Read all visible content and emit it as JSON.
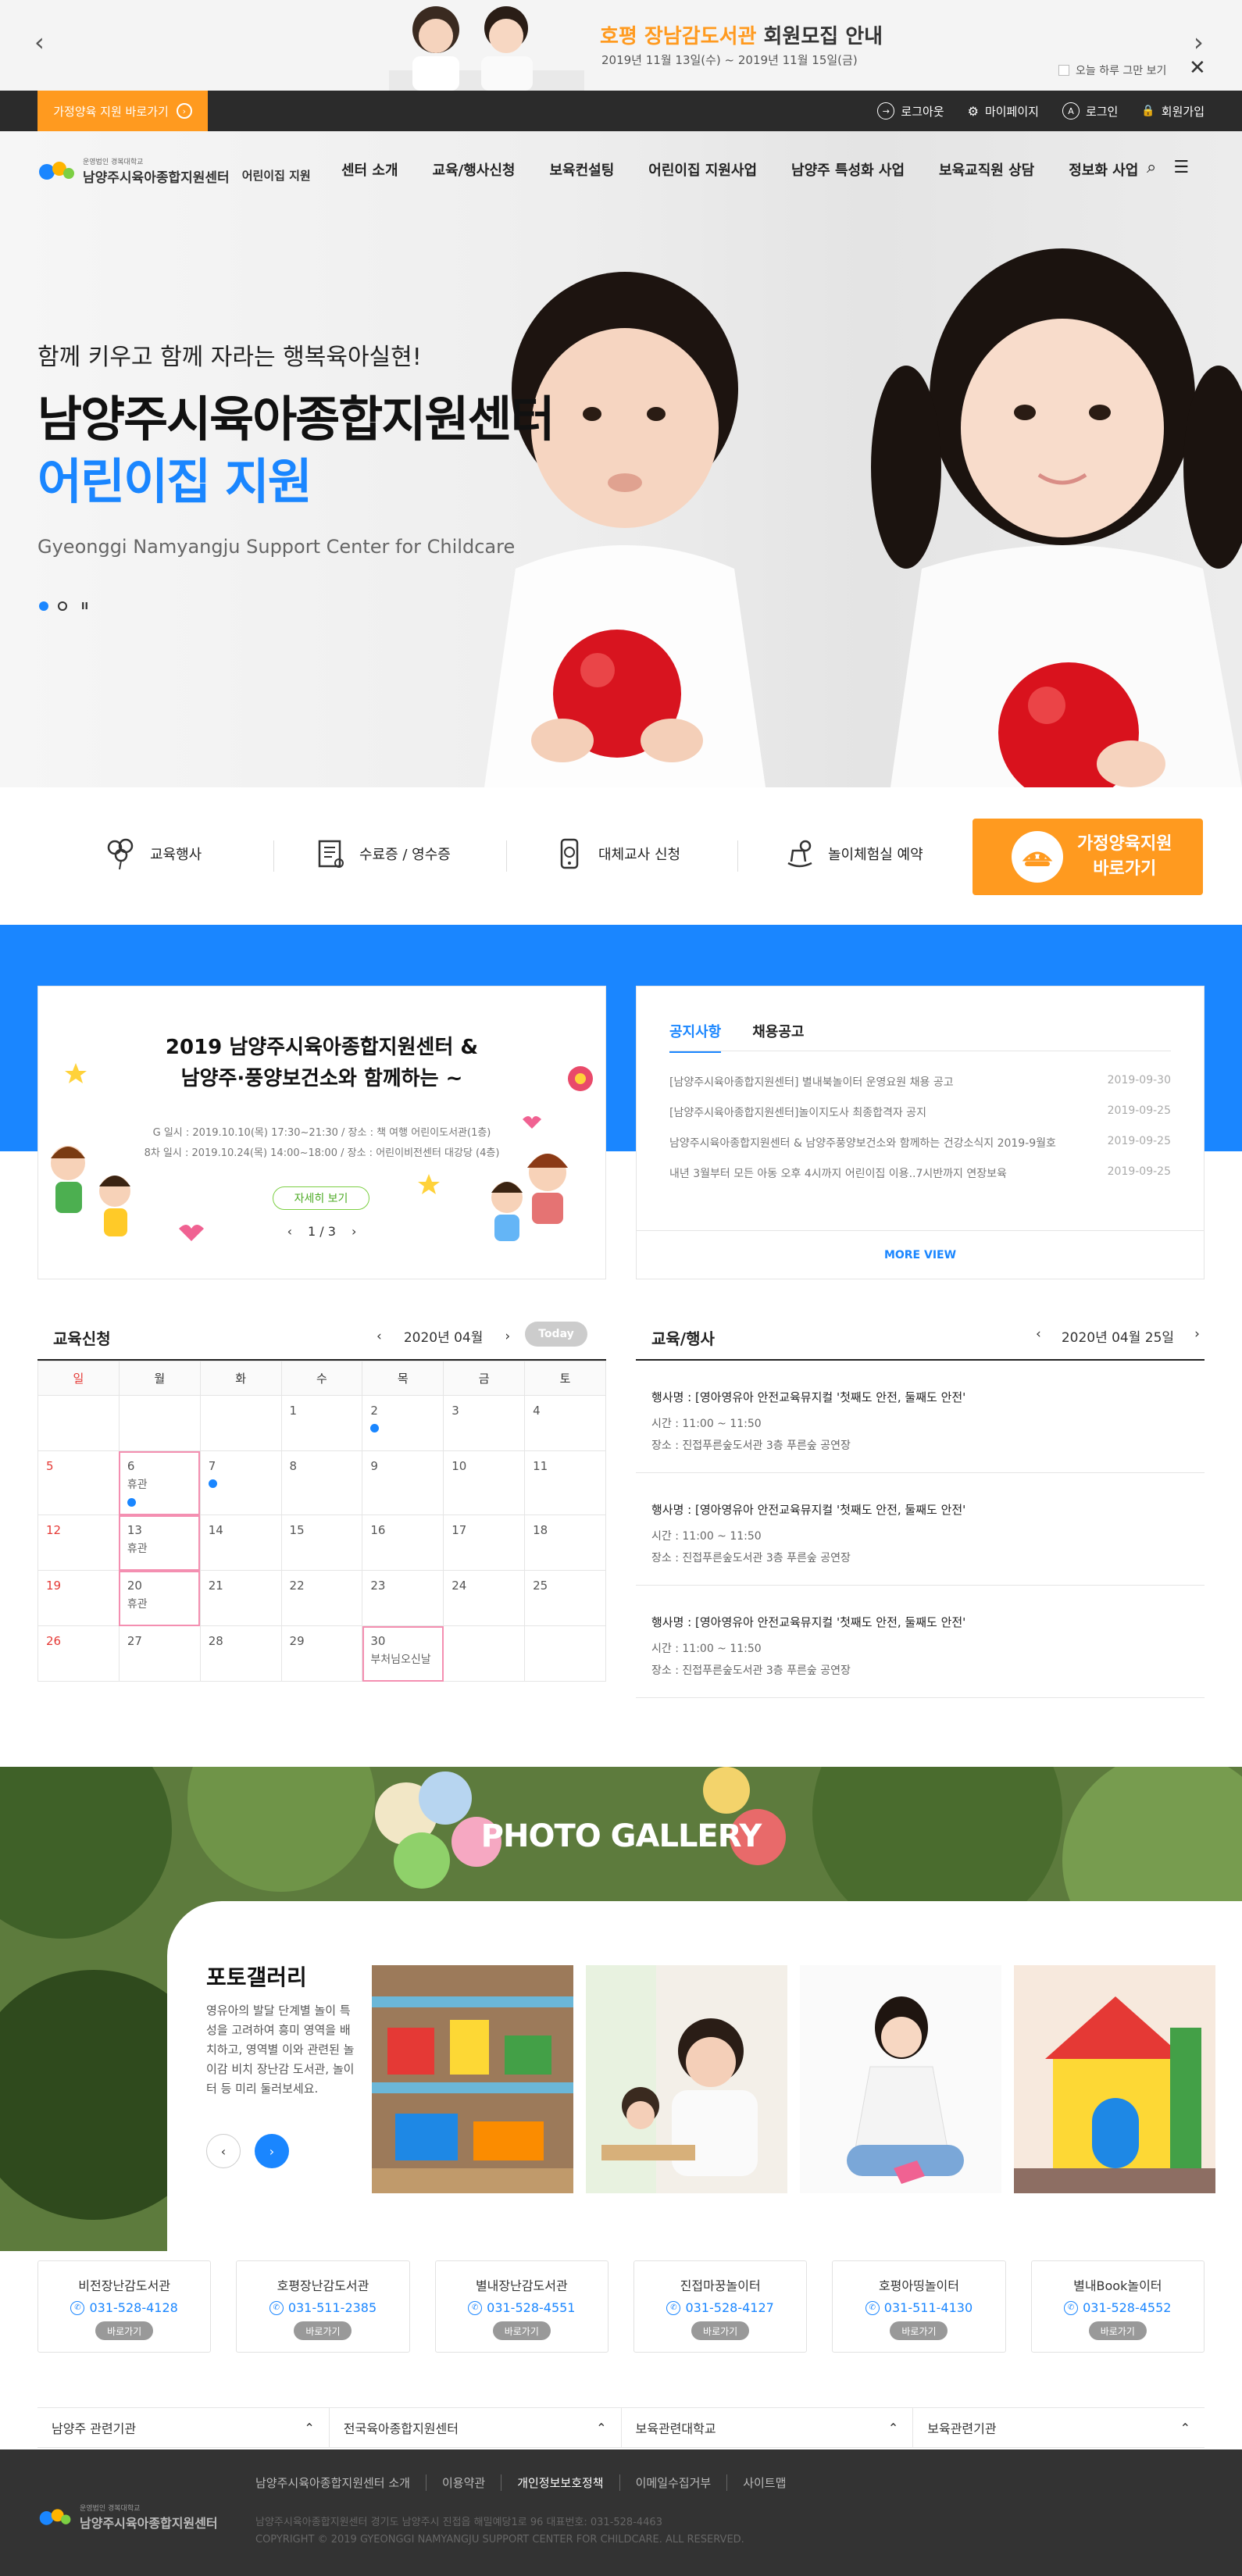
{
  "promo": {
    "title_highlight": "호평 장남감도서관",
    "title_rest": " 회원모집 안내",
    "date": "2019년 11월 13일(수) ~ 2019년 11월 15일(금)",
    "today_label": "오늘 하루 그만 보기",
    "close_icon": "close-icon",
    "prev_icon": "chevron-left-icon",
    "next_icon": "chevron-right-icon"
  },
  "util": {
    "home_btn": "가정양육 지원 바로가기",
    "links": [
      {
        "label": "로그아웃",
        "icon": "logout-icon",
        "glyph": "→"
      },
      {
        "label": "마이페이지",
        "icon": "gear-icon",
        "glyph": "⚙"
      },
      {
        "label": "로그인",
        "icon": "login-icon",
        "glyph": "A"
      },
      {
        "label": "회원가입",
        "icon": "lock-icon",
        "glyph": "🔒"
      }
    ]
  },
  "gnb": {
    "logo_small": "운영법인 경복대학교",
    "logo_name": "남양주시육아종합지원센터",
    "logo_sub": "어린이집 지원",
    "menu": [
      "센터 소개",
      "교육/행사신청",
      "보육컨설팅",
      "어린이집 지원사업",
      "남양주 특성화 사업",
      "보육교직원 상담",
      "정보화 사업"
    ]
  },
  "hero": {
    "slogan": "함께 키우고 함께 자라는 행복육아실현!",
    "title1": "남양주시육아종합지원센터",
    "title2": "어린이집 지원",
    "en": "Gyeonggi Namyangju Support Center for Childcare",
    "pause": "II"
  },
  "quick": {
    "items": [
      {
        "label": "교육행사",
        "icon": "balloon-icon"
      },
      {
        "label": "수료증 / 영수증",
        "icon": "certificate-icon"
      },
      {
        "label": "대체교사 신청",
        "icon": "phone-icon"
      },
      {
        "label": "놀이체험실 예약",
        "icon": "rocking-horse-icon"
      }
    ],
    "cta_line1": "가정양육지원",
    "cta_line2": "바로가기"
  },
  "event": {
    "title1": "2019 남양주시육아종합지원센터 &",
    "title2": "남양주·풍양보건소와 함께하는 ~",
    "info1": "G 일시 : 2019.10.10(목) 17:30~21:30 / 장소 : 책 여행 어린이도서관(1층)",
    "info2": "8차 일시 : 2019.10.24(목) 14:00~18:00 / 장소 : 어린이비전센터 대강당 (4층)",
    "more": "자세히 보기",
    "pager": "1 / 3"
  },
  "notice": {
    "tabs": [
      "공지사항",
      "채용공고"
    ],
    "rows": [
      {
        "title": "[남양주시육아종합지원센터] 별내북놀이터 운영요원 채용 공고",
        "date": "2019-09-30"
      },
      {
        "title": "[남양주시육아종합지원센터]놀이지도사 최종합격자 공지",
        "date": "2019-09-25"
      },
      {
        "title": "남양주시육아종합지원센터 & 남양주풍양보건소와 함께하는 건강소식지 2019-9월호",
        "date": "2019-09-25"
      },
      {
        "title": "내년 3월부터 모든 아동 오후 4시까지 어린이집 이용..7시반까지 연장보육",
        "date": "2019-09-25"
      }
    ],
    "more": "MORE VIEW"
  },
  "calendar": {
    "title": "교육신청",
    "month": "2020년 04월",
    "today": "Today",
    "weekdays": [
      "일",
      "월",
      "화",
      "수",
      "목",
      "금",
      "토"
    ],
    "weeks": [
      [
        {
          "d": ""
        },
        {
          "d": ""
        },
        {
          "d": ""
        },
        {
          "d": "1"
        },
        {
          "d": "2",
          "ev": true
        },
        {
          "d": "3"
        },
        {
          "d": "4"
        }
      ],
      [
        {
          "d": "5"
        },
        {
          "d": "6",
          "lab": "휴관",
          "ev": true,
          "hl": true
        },
        {
          "d": "7",
          "ev": true
        },
        {
          "d": "8"
        },
        {
          "d": "9"
        },
        {
          "d": "10"
        },
        {
          "d": "11"
        }
      ],
      [
        {
          "d": "12"
        },
        {
          "d": "13",
          "lab": "휴관",
          "hl": true
        },
        {
          "d": "14"
        },
        {
          "d": "15"
        },
        {
          "d": "16"
        },
        {
          "d": "17"
        },
        {
          "d": "18"
        }
      ],
      [
        {
          "d": "19"
        },
        {
          "d": "20",
          "lab": "휴관",
          "hl": true
        },
        {
          "d": "21"
        },
        {
          "d": "22"
        },
        {
          "d": "23"
        },
        {
          "d": "24"
        },
        {
          "d": "25"
        }
      ],
      [
        {
          "d": "26"
        },
        {
          "d": "27"
        },
        {
          "d": "28"
        },
        {
          "d": "29"
        },
        {
          "d": "30",
          "lab": "부처님오신날",
          "hl": true
        },
        {
          "d": ""
        },
        {
          "d": ""
        }
      ]
    ]
  },
  "events": {
    "title": "교육/행사",
    "date": "2020년 04월 25일",
    "items": [
      {
        "name": "행사명 : [영아영유아 안전교육뮤지컬 '첫째도 안전, 둘째도 안전'",
        "time": "시간 : 11:00 ~ 11:50",
        "place": "장소 : 진접푸른숲도서관 3층 푸른숲 공연장"
      },
      {
        "name": "행사명 : [영아영유아 안전교육뮤지컬 '첫째도 안전, 둘째도 안전'",
        "time": "시간 : 11:00 ~ 11:50",
        "place": "장소 : 진접푸른숲도서관 3층 푸른숲 공연장"
      },
      {
        "name": "행사명 : [영아영유아 안전교육뮤지컬 '첫째도 안전, 둘째도 안전'",
        "time": "시간 : 11:00 ~ 11:50",
        "place": "장소 : 진접푸른숲도서관 3층 푸른숲 공연장"
      }
    ]
  },
  "gallery": {
    "banner": "PHOTO GALLERY",
    "title": "포토갤러리",
    "desc": "영유아의 발달 단계별 놀이 특성을 고려하여 흥미 영역을 배치하고, 영역별 이와 관련된 놀이감 비치 장난감 도서관, 놀이터 등 미리 둘러보세요."
  },
  "institutions": [
    {
      "name": "비전장난감도서관",
      "phone": "031-528-4128",
      "go": "바로가기"
    },
    {
      "name": "호평장난감도서관",
      "phone": "031-511-2385",
      "go": "바로가기"
    },
    {
      "name": "별내장난감도서관",
      "phone": "031-528-4551",
      "go": "바로가기"
    },
    {
      "name": "진접마꿍놀이터",
      "phone": "031-528-4127",
      "go": "바로가기"
    },
    {
      "name": "호평아띵놀이터",
      "phone": "031-511-4130",
      "go": "바로가기"
    },
    {
      "name": "별내Book놀이터",
      "phone": "031-528-4552",
      "go": "바로가기"
    }
  ],
  "related": [
    "남양주 관련기관",
    "전국육아종합지원센터",
    "보육관련대학교",
    "보육관련기관"
  ],
  "footer": {
    "logo_small": "운영법인 경복대학교",
    "logo_name": "남양주시육아종합지원센터",
    "links": [
      "남양주시육아종합지원센터 소개",
      "이용약관",
      "개인정보보호정책",
      "이메일수집거부",
      "사이트맵"
    ],
    "addr": "남양주시육아종합지원센터  경기도 남양주시 진접읍 해밀예당1로 96     대표번호: 031-528-4463",
    "copy": "COPYRIGHT © 2019 GYEONGGI NAMYANGJU SUPPORT CENTER FOR CHILDCARE. ALL RESERVED."
  },
  "colors": {
    "blue": "#1a86ff",
    "orange": "#ff9a1f",
    "dark": "#2b2b2b"
  }
}
